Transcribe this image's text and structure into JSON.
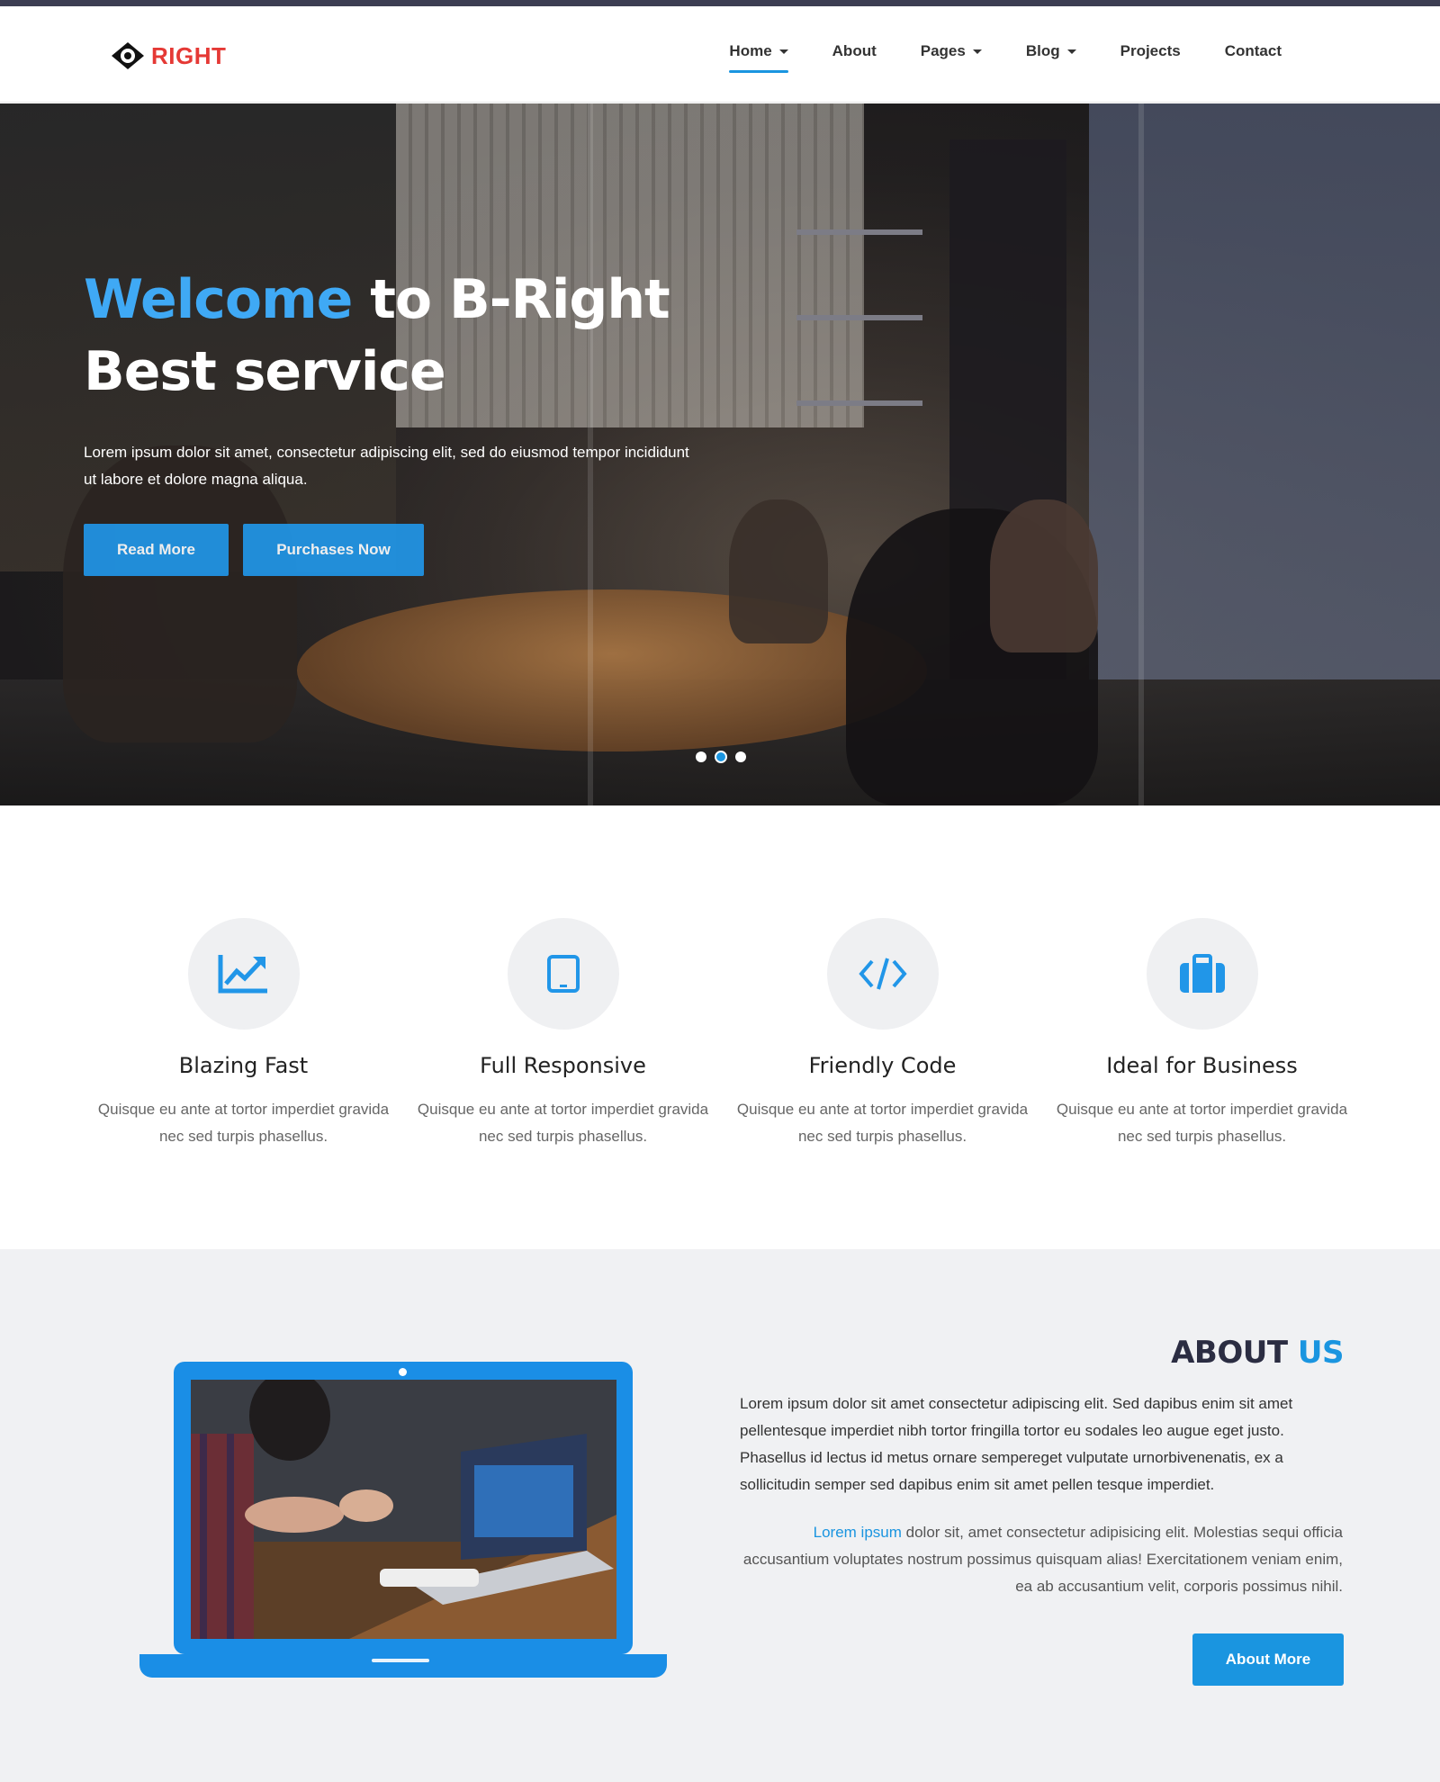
{
  "brand": {
    "name": "RIGHT",
    "color": "#e53935"
  },
  "nav": {
    "items": [
      {
        "label": "Home",
        "dropdown": true,
        "active": true
      },
      {
        "label": "About",
        "dropdown": false,
        "active": false
      },
      {
        "label": "Pages",
        "dropdown": true,
        "active": false
      },
      {
        "label": "Blog",
        "dropdown": true,
        "active": false
      },
      {
        "label": "Projects",
        "dropdown": false,
        "active": false
      },
      {
        "label": "Contact",
        "dropdown": false,
        "active": false
      }
    ]
  },
  "hero": {
    "title_accent": "Welcome",
    "title_rest": " to B-Right",
    "title_line2": "Best service",
    "text": "Lorem ipsum dolor sit amet, consectetur adipiscing elit, sed do eiusmod tempor incididunt ut labore et dolore magna aliqua.",
    "read_more": "Read More",
    "purchase": "Purchases Now",
    "slides": 3,
    "active_slide": 2
  },
  "features": [
    {
      "icon": "chart-line-icon",
      "title": "Blazing Fast",
      "desc": "Quisque eu ante at tortor imperdiet gravida nec sed turpis phasellus."
    },
    {
      "icon": "tablet-icon",
      "title": "Full Responsive",
      "desc": "Quisque eu ante at tortor imperdiet gravida nec sed turpis phasellus."
    },
    {
      "icon": "code-icon",
      "title": "Friendly Code",
      "desc": "Quisque eu ante at tortor imperdiet gravida nec sed turpis phasellus."
    },
    {
      "icon": "briefcase-icon",
      "title": "Ideal for Business",
      "desc": "Quisque eu ante at tortor imperdiet gravida nec sed turpis phasellus."
    }
  ],
  "about": {
    "title_main": "ABOUT ",
    "title_accent": "US",
    "p1": "Lorem ipsum dolor sit amet consectetur adipiscing elit. Sed dapibus enim sit amet pellentesque imperdiet nibh tortor fringilla tortor eu sodales leo augue eget justo. Phasellus id lectus id metus ornare sempereget vulputate urnorbivenenatis, ex a sollicitudin semper sed dapibus enim sit amet pellen tesque imperdiet.",
    "p2_link": "Lorem ipsum",
    "p2_rest": " dolor sit, amet consectetur adipisicing elit. Molestias sequi officia accusantium voluptates nostrum possimus quisquam alias! Exercitationem veniam enim, ea ab accusantium velit, corporis possimus nihil.",
    "button": "About More"
  },
  "colors": {
    "accent": "#1a95e0",
    "hero_accent": "#3fa9f5",
    "about_bg": "#f0f1f3",
    "icon_circle": "#eff0f2"
  }
}
